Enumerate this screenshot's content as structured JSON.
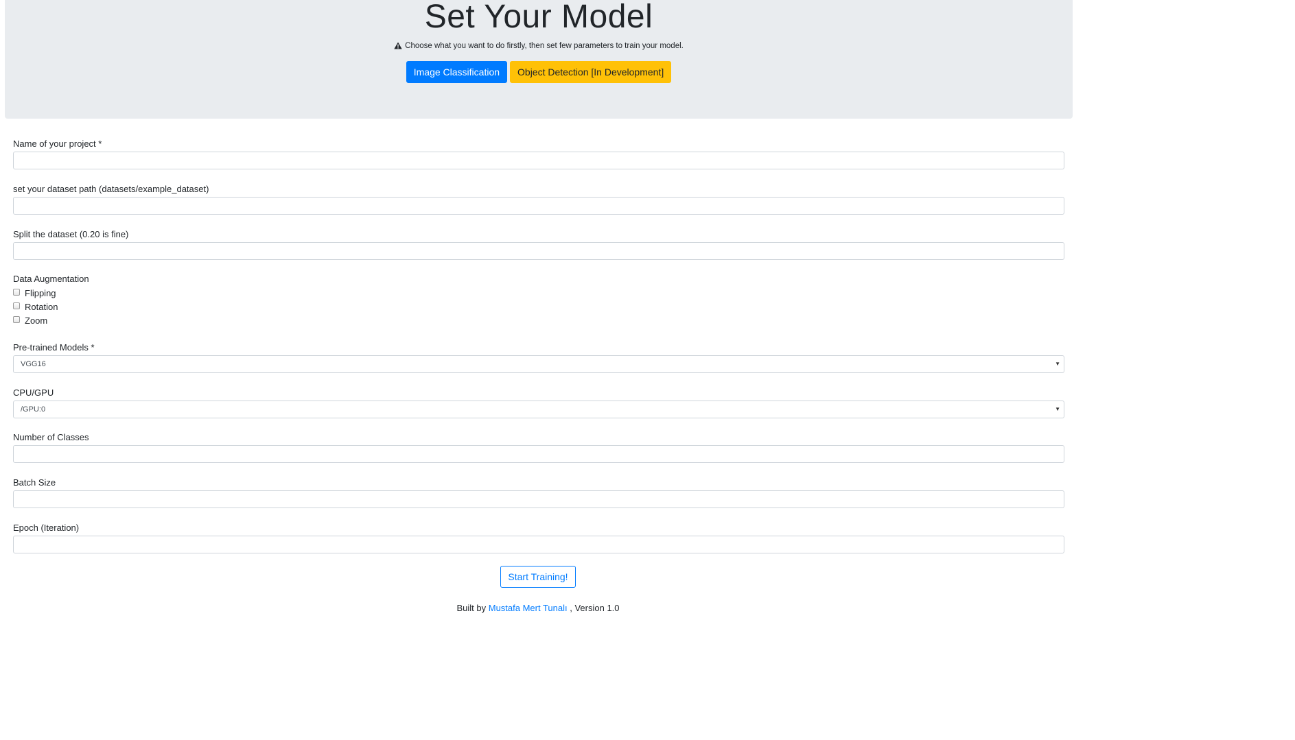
{
  "header": {
    "title": "Set Your Model",
    "subtitle": "Choose what you want to do firstly, then set few parameters to train your model.",
    "warning_icon": "warning-triangle-icon",
    "buttons": {
      "image_classification": "Image Classification",
      "object_detection": "Object Detection [In Development]"
    }
  },
  "form": {
    "project_name": {
      "label": "Name of your project *",
      "value": ""
    },
    "dataset_path": {
      "label": "set your dataset path (datasets/example_dataset)",
      "value": ""
    },
    "split": {
      "label": "Split the dataset (0.20 is fine)",
      "value": ""
    },
    "augmentation": {
      "label": "Data Augmentation",
      "options": [
        {
          "label": "Flipping",
          "checked": false
        },
        {
          "label": "Rotation",
          "checked": false
        },
        {
          "label": "Zoom",
          "checked": false
        }
      ]
    },
    "pretrained": {
      "label": "Pre-trained Models *",
      "selected": "VGG16"
    },
    "device": {
      "label": "CPU/GPU",
      "selected": "/GPU:0"
    },
    "num_classes": {
      "label": "Number of Classes",
      "value": ""
    },
    "batch_size": {
      "label": "Batch Size",
      "value": ""
    },
    "epoch": {
      "label": "Epoch (Iteration)",
      "value": ""
    },
    "submit_label": "Start Training!"
  },
  "footer": {
    "prefix": "Built by",
    "author": "Mustafa Mert Tunalı",
    "suffix": ", Version 1.0"
  },
  "colors": {
    "primary": "#007bff",
    "warning": "#ffc107",
    "jumbotron_bg": "#e9ecef"
  }
}
